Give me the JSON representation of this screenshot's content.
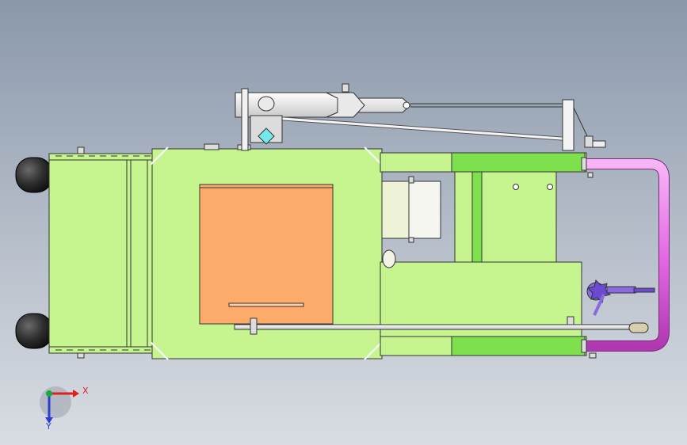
{
  "triad": {
    "x_label": "X",
    "y_label": "Y"
  },
  "colors": {
    "background_top": "#8a98ab",
    "background_bottom": "#d9dde3",
    "frame_green": "#c6f58f",
    "rail_green": "#7fe04e",
    "panel_orange": "#fdab6b",
    "hose_magenta": "#e46be4",
    "wheel_dark": "#2a2a2a",
    "lever_purple": "#8a6ae0",
    "axis_x_red": "#e0201c",
    "axis_y_blue": "#2a3fd0",
    "origin_green": "#1fa83a"
  }
}
